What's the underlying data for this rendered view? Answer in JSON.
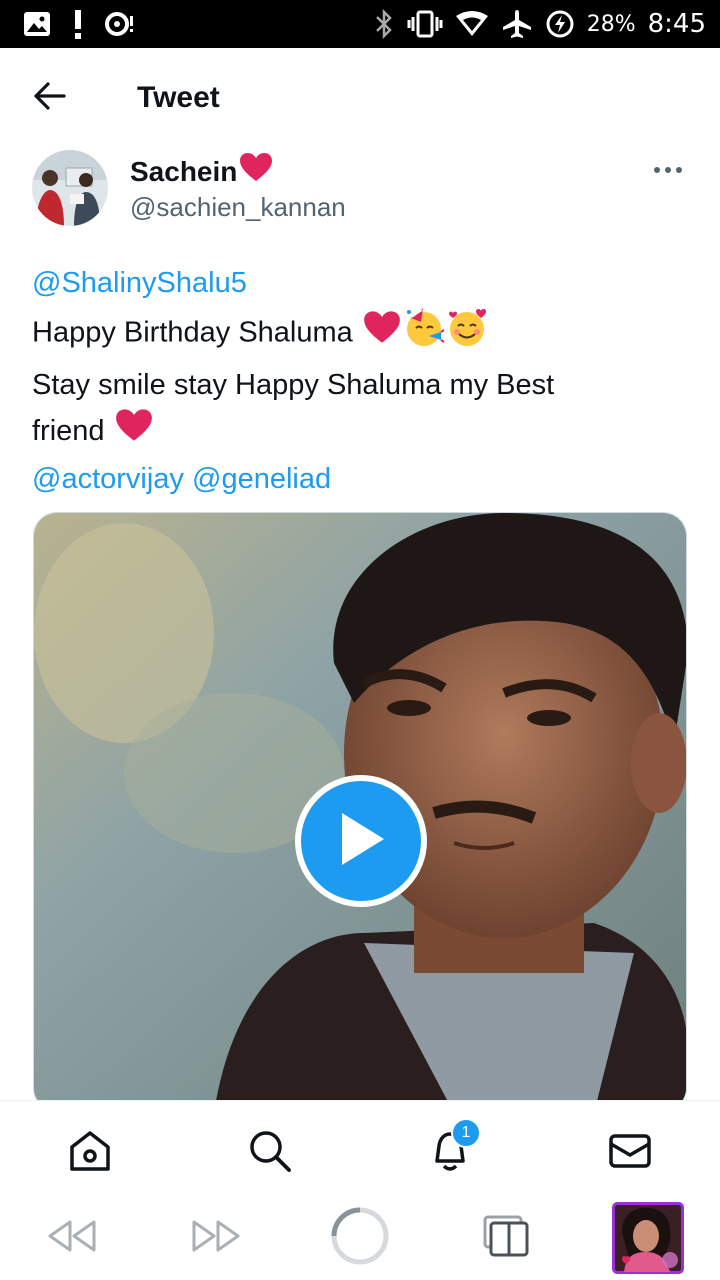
{
  "status_bar": {
    "battery": "28%",
    "time": "8:45",
    "left_icons": [
      "image-icon",
      "exclamation-icon",
      "record-icon"
    ],
    "right_icons": [
      "bluetooth-icon",
      "vibrate-icon",
      "wifi-icon",
      "airplane-icon",
      "battery-charging-icon"
    ]
  },
  "header": {
    "title": "Tweet",
    "back_icon": "back-arrow-icon"
  },
  "author": {
    "name": "Sachein",
    "name_emoji": "red-heart-icon",
    "handle": "@sachien_kannan",
    "more_icon": "more-icon"
  },
  "tweet": {
    "mention_top": "@ShalinyShalu5",
    "line1": "Happy Birthday Shaluma ",
    "line2": "Stay smile stay Happy Shaluma my Best",
    "line3": "friend ",
    "mention_a": "@actorvijay",
    "mention_b": "@geneliad"
  },
  "media": {
    "play_icon": "play-icon"
  },
  "bottom_nav": {
    "items": [
      "home-icon",
      "search-icon",
      "notifications-icon",
      "messages-icon"
    ],
    "notification_count": "1"
  },
  "system_nav": {
    "items": [
      "rewind-icon",
      "fast-forward-icon",
      "home-circle-icon",
      "recents-icon",
      "app-thumbnail"
    ]
  },
  "colors": {
    "accent": "#1d9bf0",
    "text": "#0f1419",
    "secondary": "#536471",
    "heart": "#e0245e"
  }
}
